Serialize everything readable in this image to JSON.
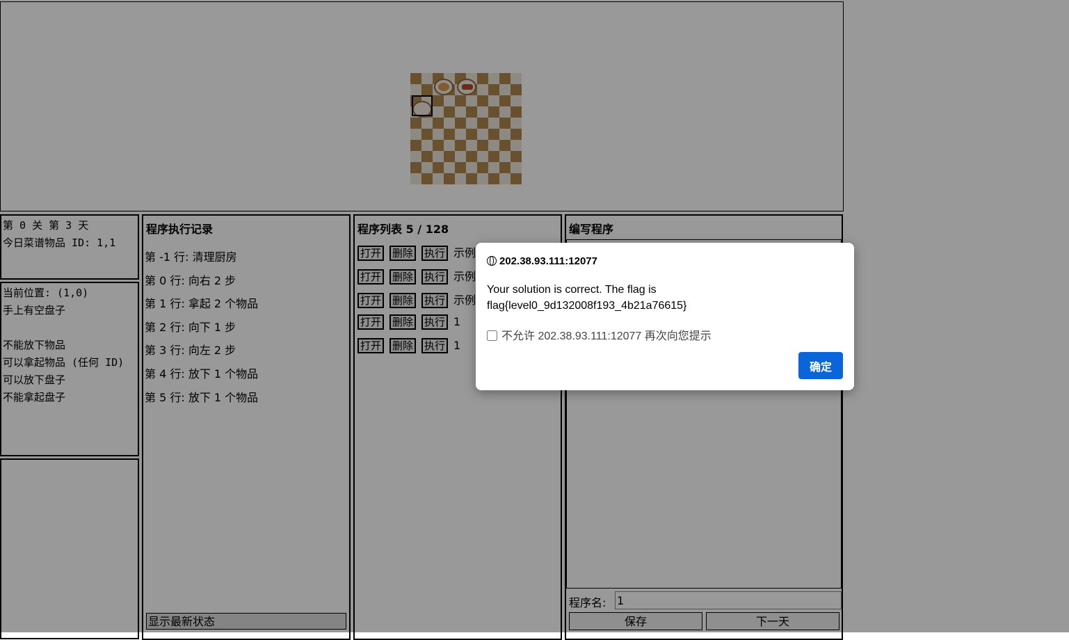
{
  "status": {
    "level_day": "第 0 关 第 3 天",
    "recipe": "今日菜谱物品 ID: 1,1"
  },
  "position": {
    "lines": [
      "当前位置: (1,0)",
      "手上有空盘子",
      "",
      "不能放下物品",
      "可以拿起物品 (任何 ID)",
      "可以放下盘子",
      "不能拿起盘子"
    ]
  },
  "log": {
    "title": "程序执行记录",
    "lines": [
      "第 -1 行: 清理厨房",
      "第 0 行: 向右 2 步",
      "第 1 行: 拿起 2 个物品",
      "第 2 行: 向下 1 步",
      "第 3 行: 向左 2 步",
      "第 4 行: 放下 1 个物品",
      "第 5 行: 放下 1 个物品"
    ],
    "show_latest": "显示最新状态"
  },
  "programs": {
    "title": "程序列表 5 / 128",
    "open_label": "打开",
    "delete_label": "删除",
    "run_label": "执行",
    "names": [
      "示例",
      "示例",
      "示例",
      "1",
      "1"
    ]
  },
  "editor": {
    "title": "编写程序",
    "name_label": "程序名:",
    "name_value": "1",
    "save_label": "保存",
    "next_day_label": "下一天"
  },
  "dialog": {
    "origin": "202.38.93.111:12077",
    "message": "Your solution is correct. The flag is flag{level0_9d132008f193_4b21a76615}",
    "checkbox_label": "不允许 202.38.93.111:12077 再次向您提示",
    "ok_label": "确定"
  },
  "colors": {
    "accent": "#0a66d8",
    "board_dark": "#b08850",
    "board_light": "#ece6dc"
  }
}
